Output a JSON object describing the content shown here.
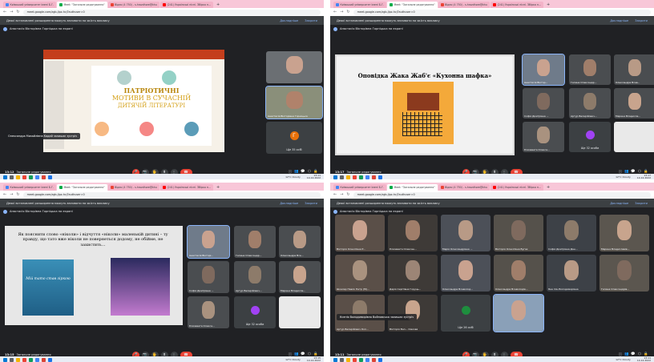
{
  "browser": {
    "tabs": [
      {
        "label": "Київський університет імені Б.Г.",
        "color": "#4285f4"
      },
      {
        "label": "Meet: \"Загальне редагування\"",
        "color": "#00ac47",
        "active": true
      },
      {
        "label": "Відео (4 750) - s.hrozdhore@khu",
        "color": "#ea4335"
      },
      {
        "label": "(241) Українські пісні. Збірка н...",
        "color": "#ff0000"
      }
    ],
    "new_tab": "+",
    "url": "meet.google.com/zgb-jlpz-hcj?authuser=0",
    "url_q3": "meet.google.com/zgb-jlpz-hcj?authuser=0"
  },
  "meet": {
    "notice": "Деякі встановлені розширення можуть впливати на якість виклику",
    "notice_details": "Докладніше",
    "notice_close": "Закрити",
    "presenter": "Анастасія Вікторівна Горніцька на екрані",
    "meeting_name": "Загальне редагування",
    "controls": [
      "🎤",
      "📷",
      "🖐",
      "⬆",
      "⋮"
    ],
    "right_controls": [
      "ⓘ",
      "👥",
      "💬",
      "⬡",
      "🔒"
    ]
  },
  "q1": {
    "time": "13:12",
    "slide": {
      "line1": "ПАТРІОТИЧНІ",
      "line2": "МОТИВИ В СУЧАСНІЙ",
      "line3": "ДИТЯЧІЙ ЛІТЕРАТУРІ"
    },
    "caption": "Олександра Михайлівна Кадай залишає зустріч",
    "tiles": [
      {
        "name": ""
      },
      {
        "name": "Анастасія Вікторівна Горніцька"
      },
      {
        "name": "Ще 35 осіб",
        "avatar": "Г"
      }
    ]
  },
  "q2": {
    "time": "13:17",
    "slide_title": "Оповідка Жака Жаб'є «Кухонна шафка»",
    "tiles": [
      "Анастасія Віктор...",
      "Галина Олександр...",
      "Олександра Всев...",
      "Софія Дмитрівна ...",
      "Артур Валерійович...",
      "Марина Владисла...",
      "Єлизавета Олекса...",
      "Ще 32 особи",
      ""
    ]
  },
  "q3": {
    "time": "13:15",
    "slide_text": "Як пояснити слово «ніколи» і відчуття «ніколи» маленькій дитині – ту правду, що тато вже ніколи не повернеться додому, не обійме, не захистить…",
    "book1": "Мій тато став зіркою",
    "tiles": [
      "Анастасія Вікторі...",
      "Галина Олександр...",
      "Олександра Все...",
      "Софія Дмитрівна ...",
      "Артур Валерійович...",
      "Марина Владисла...",
      "Єлизавета Олекса...",
      "Ще 32 особи",
      ""
    ]
  },
  "q4": {
    "time": "13:11",
    "caption": "Ксенія Володимирівна Войновська залишає зустріч",
    "tiles": [
      "Вікторія Олексіївна Р...",
      "Єлизавета Олексан...",
      "Марія Олександрівна ...",
      "Вікторія Олексіївна Вугак",
      "Софія Дмитрівна Дан...",
      "Марина Владиславів...",
      "Шкалар Павло Петр (Ю)...",
      "Дарія Сергіївна Горуць...",
      "Олександра Всеволод...",
      "Олександра Всеволодів...",
      "Яна Ілін Володимирівна",
      "Галина Олександрів...",
      "Артур Валерійович Кол...",
      "Вікторія Вал... Сівкова",
      "Ще 26 осіб",
      ""
    ]
  },
  "taskbar": {
    "weather": "12°C  Cloudy",
    "time": "13:11",
    "date": "14.12.2022",
    "time2": "13:17",
    "time3": "13:15",
    "time4": "13:11"
  },
  "colors": {
    "meet_bg": "#202124",
    "tile_bg": "#3c4043",
    "hangup": "#ea4335",
    "accent": "#8ab4f8",
    "tab_strip": "#f8c7d8"
  }
}
